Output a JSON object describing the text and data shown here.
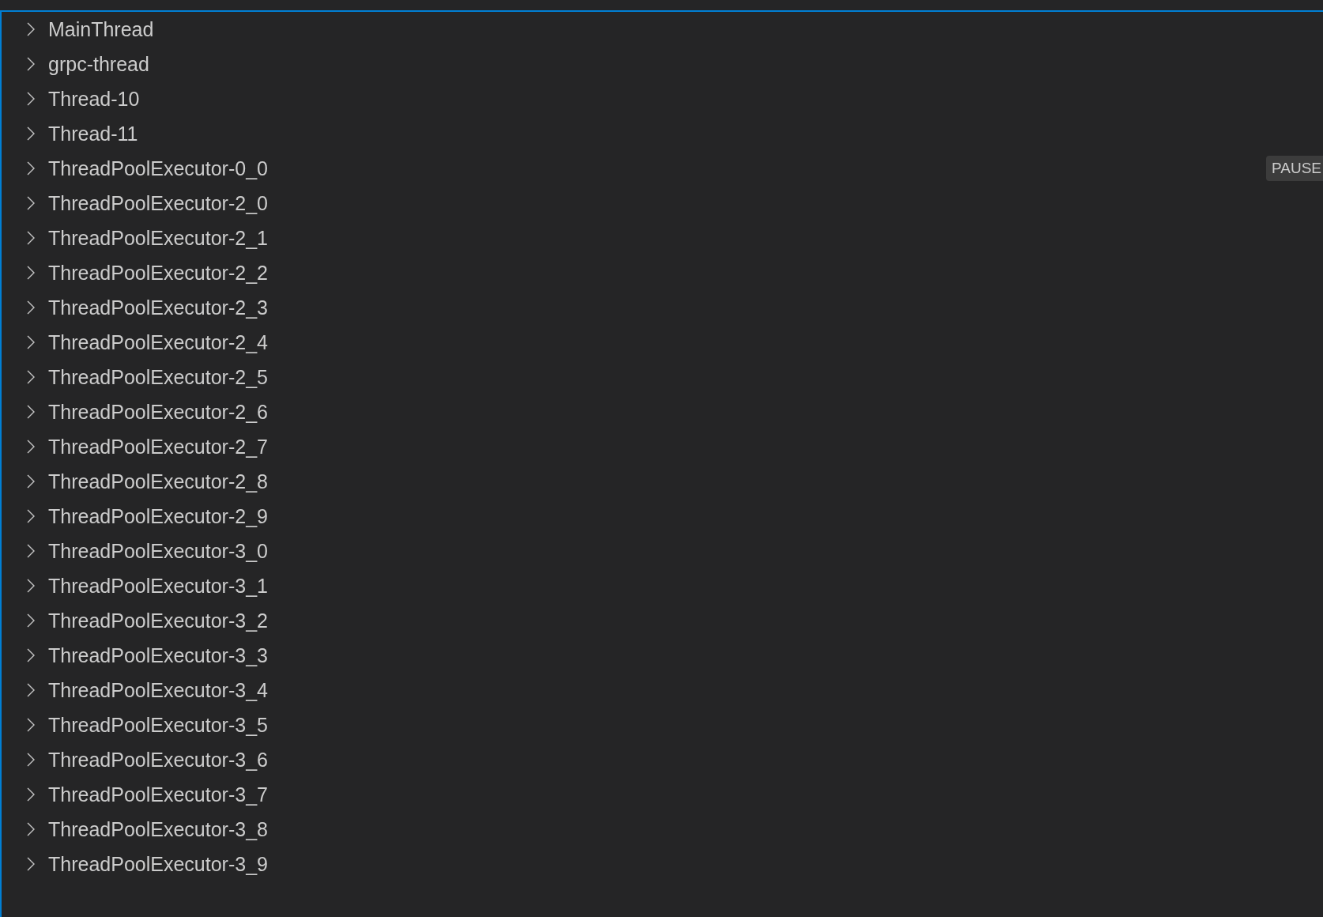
{
  "call_stack": {
    "threads": [
      {
        "name": "MainThread",
        "expanded": false
      },
      {
        "name": "grpc-thread",
        "expanded": false
      },
      {
        "name": "Thread-10",
        "expanded": false
      },
      {
        "name": "Thread-11",
        "expanded": false
      },
      {
        "name": "ThreadPoolExecutor-0_0",
        "expanded": false,
        "badge": "PAUSE"
      },
      {
        "name": "ThreadPoolExecutor-2_0",
        "expanded": false
      },
      {
        "name": "ThreadPoolExecutor-2_1",
        "expanded": false
      },
      {
        "name": "ThreadPoolExecutor-2_2",
        "expanded": false
      },
      {
        "name": "ThreadPoolExecutor-2_3",
        "expanded": false
      },
      {
        "name": "ThreadPoolExecutor-2_4",
        "expanded": false
      },
      {
        "name": "ThreadPoolExecutor-2_5",
        "expanded": false
      },
      {
        "name": "ThreadPoolExecutor-2_6",
        "expanded": false
      },
      {
        "name": "ThreadPoolExecutor-2_7",
        "expanded": false
      },
      {
        "name": "ThreadPoolExecutor-2_8",
        "expanded": false
      },
      {
        "name": "ThreadPoolExecutor-2_9",
        "expanded": false
      },
      {
        "name": "ThreadPoolExecutor-3_0",
        "expanded": false
      },
      {
        "name": "ThreadPoolExecutor-3_1",
        "expanded": false
      },
      {
        "name": "ThreadPoolExecutor-3_2",
        "expanded": false
      },
      {
        "name": "ThreadPoolExecutor-3_3",
        "expanded": false
      },
      {
        "name": "ThreadPoolExecutor-3_4",
        "expanded": false
      },
      {
        "name": "ThreadPoolExecutor-3_5",
        "expanded": false
      },
      {
        "name": "ThreadPoolExecutor-3_6",
        "expanded": false
      },
      {
        "name": "ThreadPoolExecutor-3_7",
        "expanded": false
      },
      {
        "name": "ThreadPoolExecutor-3_8",
        "expanded": false
      },
      {
        "name": "ThreadPoolExecutor-3_9",
        "expanded": false
      }
    ]
  }
}
